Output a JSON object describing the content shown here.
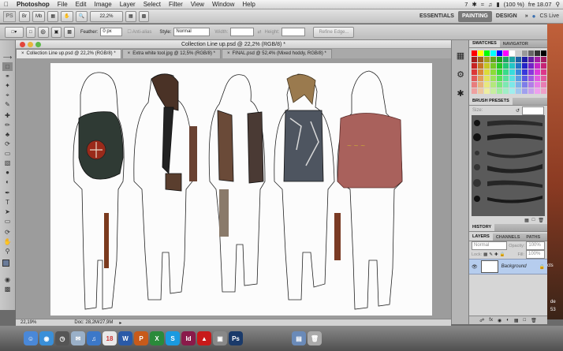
{
  "menubar": {
    "app_name": "Photoshop",
    "items": [
      "File",
      "Edit",
      "Image",
      "Layer",
      "Select",
      "Filter",
      "View",
      "Window",
      "Help"
    ],
    "status_badge": "7",
    "battery": "(100 %)",
    "clock": "fre 18.07"
  },
  "appbar": {
    "ps_logo": "PS",
    "zoom": "22,2%",
    "workspaces": [
      "ESSENTIALS",
      "PAINTING",
      "DESIGN"
    ],
    "active_workspace": "PAINTING",
    "more": "»",
    "cs_live": "CS Live"
  },
  "options": {
    "feather_label": "Feather:",
    "feather_value": "0 px",
    "antialias_label": "Anti-alias",
    "style_label": "Style:",
    "style_value": "Normal",
    "width_label": "Width:",
    "height_label": "Height:",
    "refine_edge": "Refine Edge..."
  },
  "document": {
    "window_title": "Collection Line up.psd @ 22,2% (RGB/8) *",
    "tabs": [
      {
        "label": "Collection Line up.psd @ 22,2% (RGB/8) *",
        "active": true
      },
      {
        "label": "Extra white tool.jpg @ 12,5% (RGB/8) *",
        "active": false
      },
      {
        "label": "FINAL.psd @ 52,4% (Mixed hoddy, RGB/8) *",
        "active": false
      }
    ],
    "status_zoom": "22,19%",
    "status_doc": "Doc: 28,2M/27,9M"
  },
  "panels": {
    "swatches_tabs": [
      "SWATCHES",
      "NAVIGATOR"
    ],
    "brush_presets_tab": "BRUSH PRESETS",
    "brush_size_label": "Size:",
    "history_tab": "HISTORY",
    "layers_tabs": [
      "LAYERS",
      "CHANNELS",
      "PATHS"
    ],
    "blend_mode": "Normal",
    "opacity_label": "Opacity:",
    "opacity_value": "100%",
    "lock_label": "Lock:",
    "fill_label": "Fill:",
    "fill_value": "100%",
    "layer_name": "Background"
  },
  "desktop_fragments": {
    "text1": "cts",
    "text2": "de",
    "text3": "53"
  },
  "dock": {
    "apps": [
      "Finder",
      "Safari",
      "Clock",
      "Mail",
      "iTunes",
      "Cal",
      "Word",
      "PowerPoint",
      "Excel",
      "Skype",
      "InDesign",
      "Acrobat",
      "Preview",
      "Photoshop",
      "Folder",
      "Trash"
    ]
  },
  "colors": {
    "active_tab": "#e6e6e6",
    "layer_selected": "#b6cdee",
    "close_red": "#e2463c",
    "min_yellow": "#e8b53b",
    "max_green": "#5fb84a"
  }
}
